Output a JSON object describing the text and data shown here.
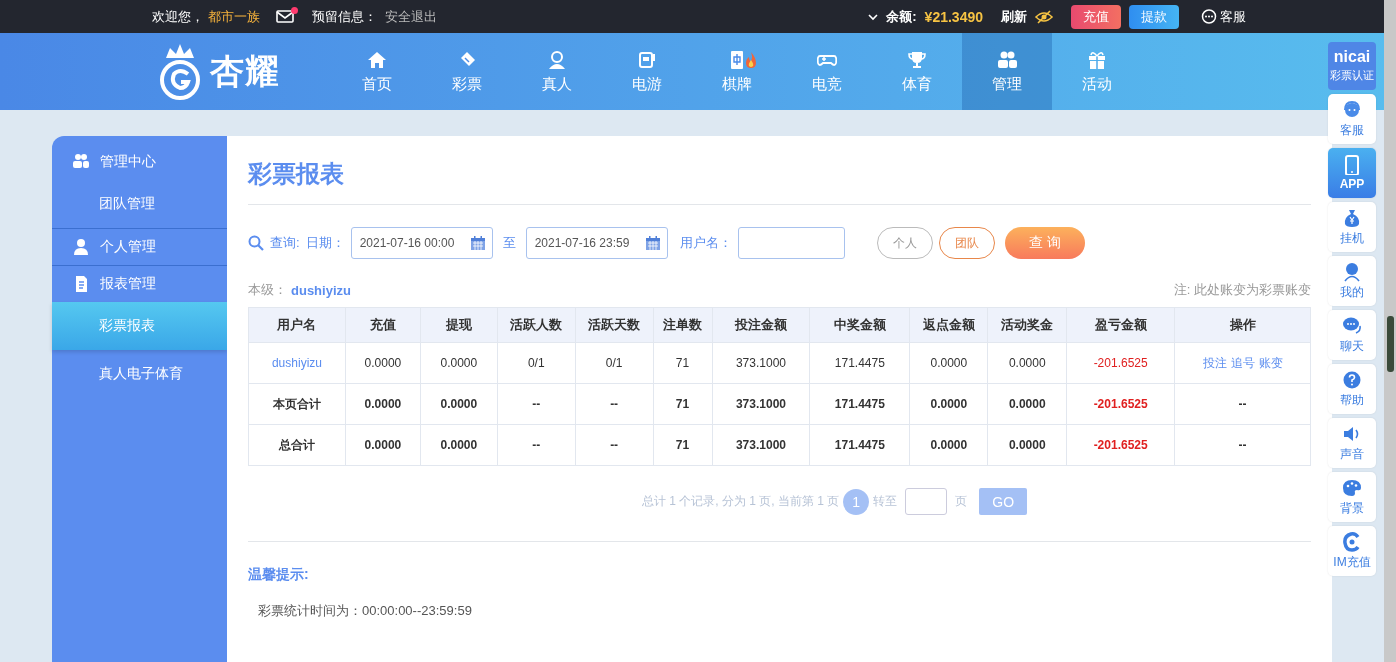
{
  "top_bar": {
    "welcome": "欢迎您，",
    "username": "都市一族",
    "mail_unread": true,
    "reserved_info": "预留信息：",
    "logout": "安全退出",
    "balance_label": "余额:",
    "balance": "¥21.3490",
    "refresh": "刷新",
    "deposit": "充值",
    "withdraw": "提款",
    "support": "客服"
  },
  "logo": "杏耀",
  "nav": [
    {
      "label": "首页",
      "selected": false
    },
    {
      "label": "彩票",
      "selected": false
    },
    {
      "label": "真人",
      "selected": false
    },
    {
      "label": "电游",
      "selected": false
    },
    {
      "label": "棋牌",
      "selected": false,
      "hot": true
    },
    {
      "label": "电竞",
      "selected": false
    },
    {
      "label": "体育",
      "selected": false
    },
    {
      "label": "管理",
      "selected": true
    },
    {
      "label": "活动",
      "selected": false
    }
  ],
  "sidebar": [
    {
      "label": "管理中心",
      "children": [
        {
          "label": "团队管理",
          "selected": false
        }
      ]
    },
    {
      "label": "个人管理"
    },
    {
      "label": "报表管理",
      "children": [
        {
          "label": "彩票报表",
          "selected": true
        },
        {
          "label": "真人电子体育",
          "selected": false
        }
      ]
    }
  ],
  "page_title": "彩票报表",
  "filter": {
    "query_label": "查询:",
    "date_label": "日期：",
    "date_from": "2021-07-16 00:00",
    "to": "至",
    "date_to": "2021-07-16 23:59",
    "username_label": "用户名：",
    "scope_buttons": [
      {
        "label": "个人",
        "selected": false
      },
      {
        "label": "团队",
        "selected": true
      }
    ],
    "submit": "查 询"
  },
  "level_label": "本级：",
  "level_user": "dushiyizu",
  "note": "注: 此处账变为彩票账变",
  "table": {
    "columns": [
      {
        "label": "用户名",
        "kind": "text"
      },
      {
        "label": "充值",
        "kind": "text"
      },
      {
        "label": "提现",
        "kind": "text"
      },
      {
        "label": "活跃人数",
        "kind": "text"
      },
      {
        "label": "活跃天数",
        "kind": "text"
      },
      {
        "label": "注单数",
        "kind": "text"
      },
      {
        "label": "投注金额",
        "kind": "text"
      },
      {
        "label": "中奖金额",
        "kind": "text"
      },
      {
        "label": "返点金额",
        "kind": "text"
      },
      {
        "label": "活动奖金",
        "kind": "text"
      },
      {
        "label": "盈亏金额",
        "kind": "loss"
      },
      {
        "label": "操作",
        "kind": "text"
      }
    ],
    "rows": [
      {
        "kind": "data",
        "cells": [
          "dushiyizu",
          "0.0000",
          "0.0000",
          "0/1",
          "0/1",
          "71",
          "373.1000",
          "171.4475",
          "0.0000",
          "0.0000",
          "-201.6525"
        ],
        "actions": [
          "投注",
          "追号",
          "账变"
        ]
      },
      {
        "kind": "total",
        "cells": [
          "本页合计",
          "0.0000",
          "0.0000",
          "--",
          "--",
          "71",
          "373.1000",
          "171.4475",
          "0.0000",
          "0.0000",
          "-201.6525",
          "--"
        ]
      },
      {
        "kind": "total",
        "cells": [
          "总合计",
          "0.0000",
          "0.0000",
          "--",
          "--",
          "71",
          "373.1000",
          "171.4475",
          "0.0000",
          "0.0000",
          "-201.6525",
          "--"
        ]
      }
    ]
  },
  "pagination": {
    "summary": "总计 1 个记录, 分为 1 页, 当前第 1 页",
    "current": "1",
    "goto": "转至",
    "page_unit": "页",
    "go": "GO"
  },
  "tips": {
    "title": "温馨提示:",
    "text": "彩票统计时间为：00:00:00--23:59:59"
  },
  "badge": {
    "brand": "nicai",
    "caption": "彩票认证"
  },
  "toolbar": [
    {
      "label": "客服",
      "selected": false
    },
    {
      "label": "APP",
      "selected": true
    },
    {
      "label": "挂机",
      "selected": false
    },
    {
      "label": "我的",
      "selected": false
    },
    {
      "label": "聊天",
      "selected": false
    },
    {
      "label": "帮助",
      "selected": false
    },
    {
      "label": "声音",
      "selected": false
    },
    {
      "label": "背景",
      "selected": false
    },
    {
      "label": "IM充值",
      "selected": false
    }
  ]
}
